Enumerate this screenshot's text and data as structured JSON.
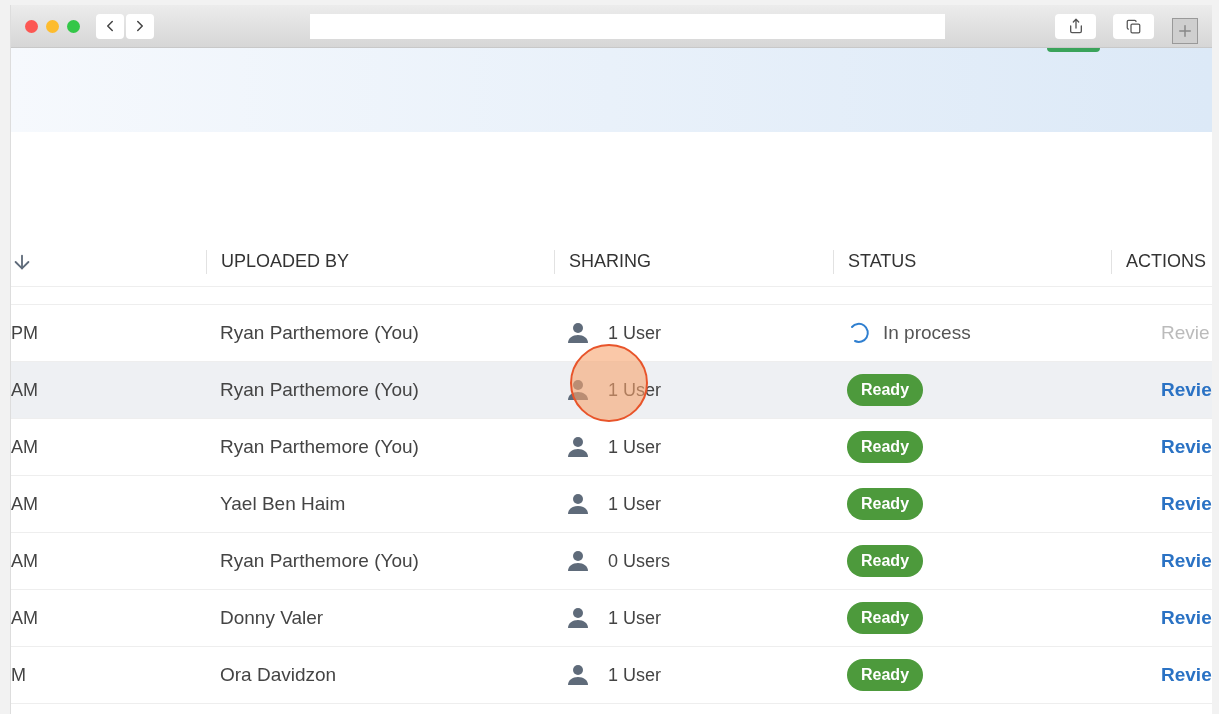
{
  "table": {
    "columns": [
      "UPLOADED BY",
      "SHARING",
      "STATUS",
      "ACTIONS"
    ],
    "rows": [
      {
        "column_1": "PM",
        "uploaded_by": "Ryan Parthemore (You)",
        "sharing": "1 User",
        "status": {
          "kind": "processing",
          "label": "In process"
        },
        "action": {
          "label": "Revie",
          "disabled": true
        },
        "selected": false
      },
      {
        "column_1": "AM",
        "uploaded_by": "Ryan Parthemore (You)",
        "sharing": "1 User",
        "status": {
          "kind": "ready",
          "label": "Ready"
        },
        "action": {
          "label": "Revie",
          "disabled": false
        },
        "selected": true
      },
      {
        "column_1": "AM",
        "uploaded_by": "Ryan Parthemore (You)",
        "sharing": "1 User",
        "status": {
          "kind": "ready",
          "label": "Ready"
        },
        "action": {
          "label": "Revie",
          "disabled": false
        },
        "selected": false
      },
      {
        "column_1": "AM",
        "uploaded_by": "Yael Ben Haim",
        "sharing": "1 User",
        "status": {
          "kind": "ready",
          "label": "Ready"
        },
        "action": {
          "label": "Revie",
          "disabled": false
        },
        "selected": false
      },
      {
        "column_1": "AM",
        "uploaded_by": "Ryan Parthemore (You)",
        "sharing": "0 Users",
        "status": {
          "kind": "ready",
          "label": "Ready"
        },
        "action": {
          "label": "Revie",
          "disabled": false
        },
        "selected": false
      },
      {
        "column_1": "AM",
        "uploaded_by": "Donny Valer",
        "sharing": "1 User",
        "status": {
          "kind": "ready",
          "label": "Ready"
        },
        "action": {
          "label": "Revie",
          "disabled": false
        },
        "selected": false
      },
      {
        "column_1": "M",
        "uploaded_by": "Ora Davidzon",
        "sharing": "1 User",
        "status": {
          "kind": "ready",
          "label": "Ready"
        },
        "action": {
          "label": "Revie",
          "disabled": false
        },
        "selected": false
      }
    ]
  }
}
